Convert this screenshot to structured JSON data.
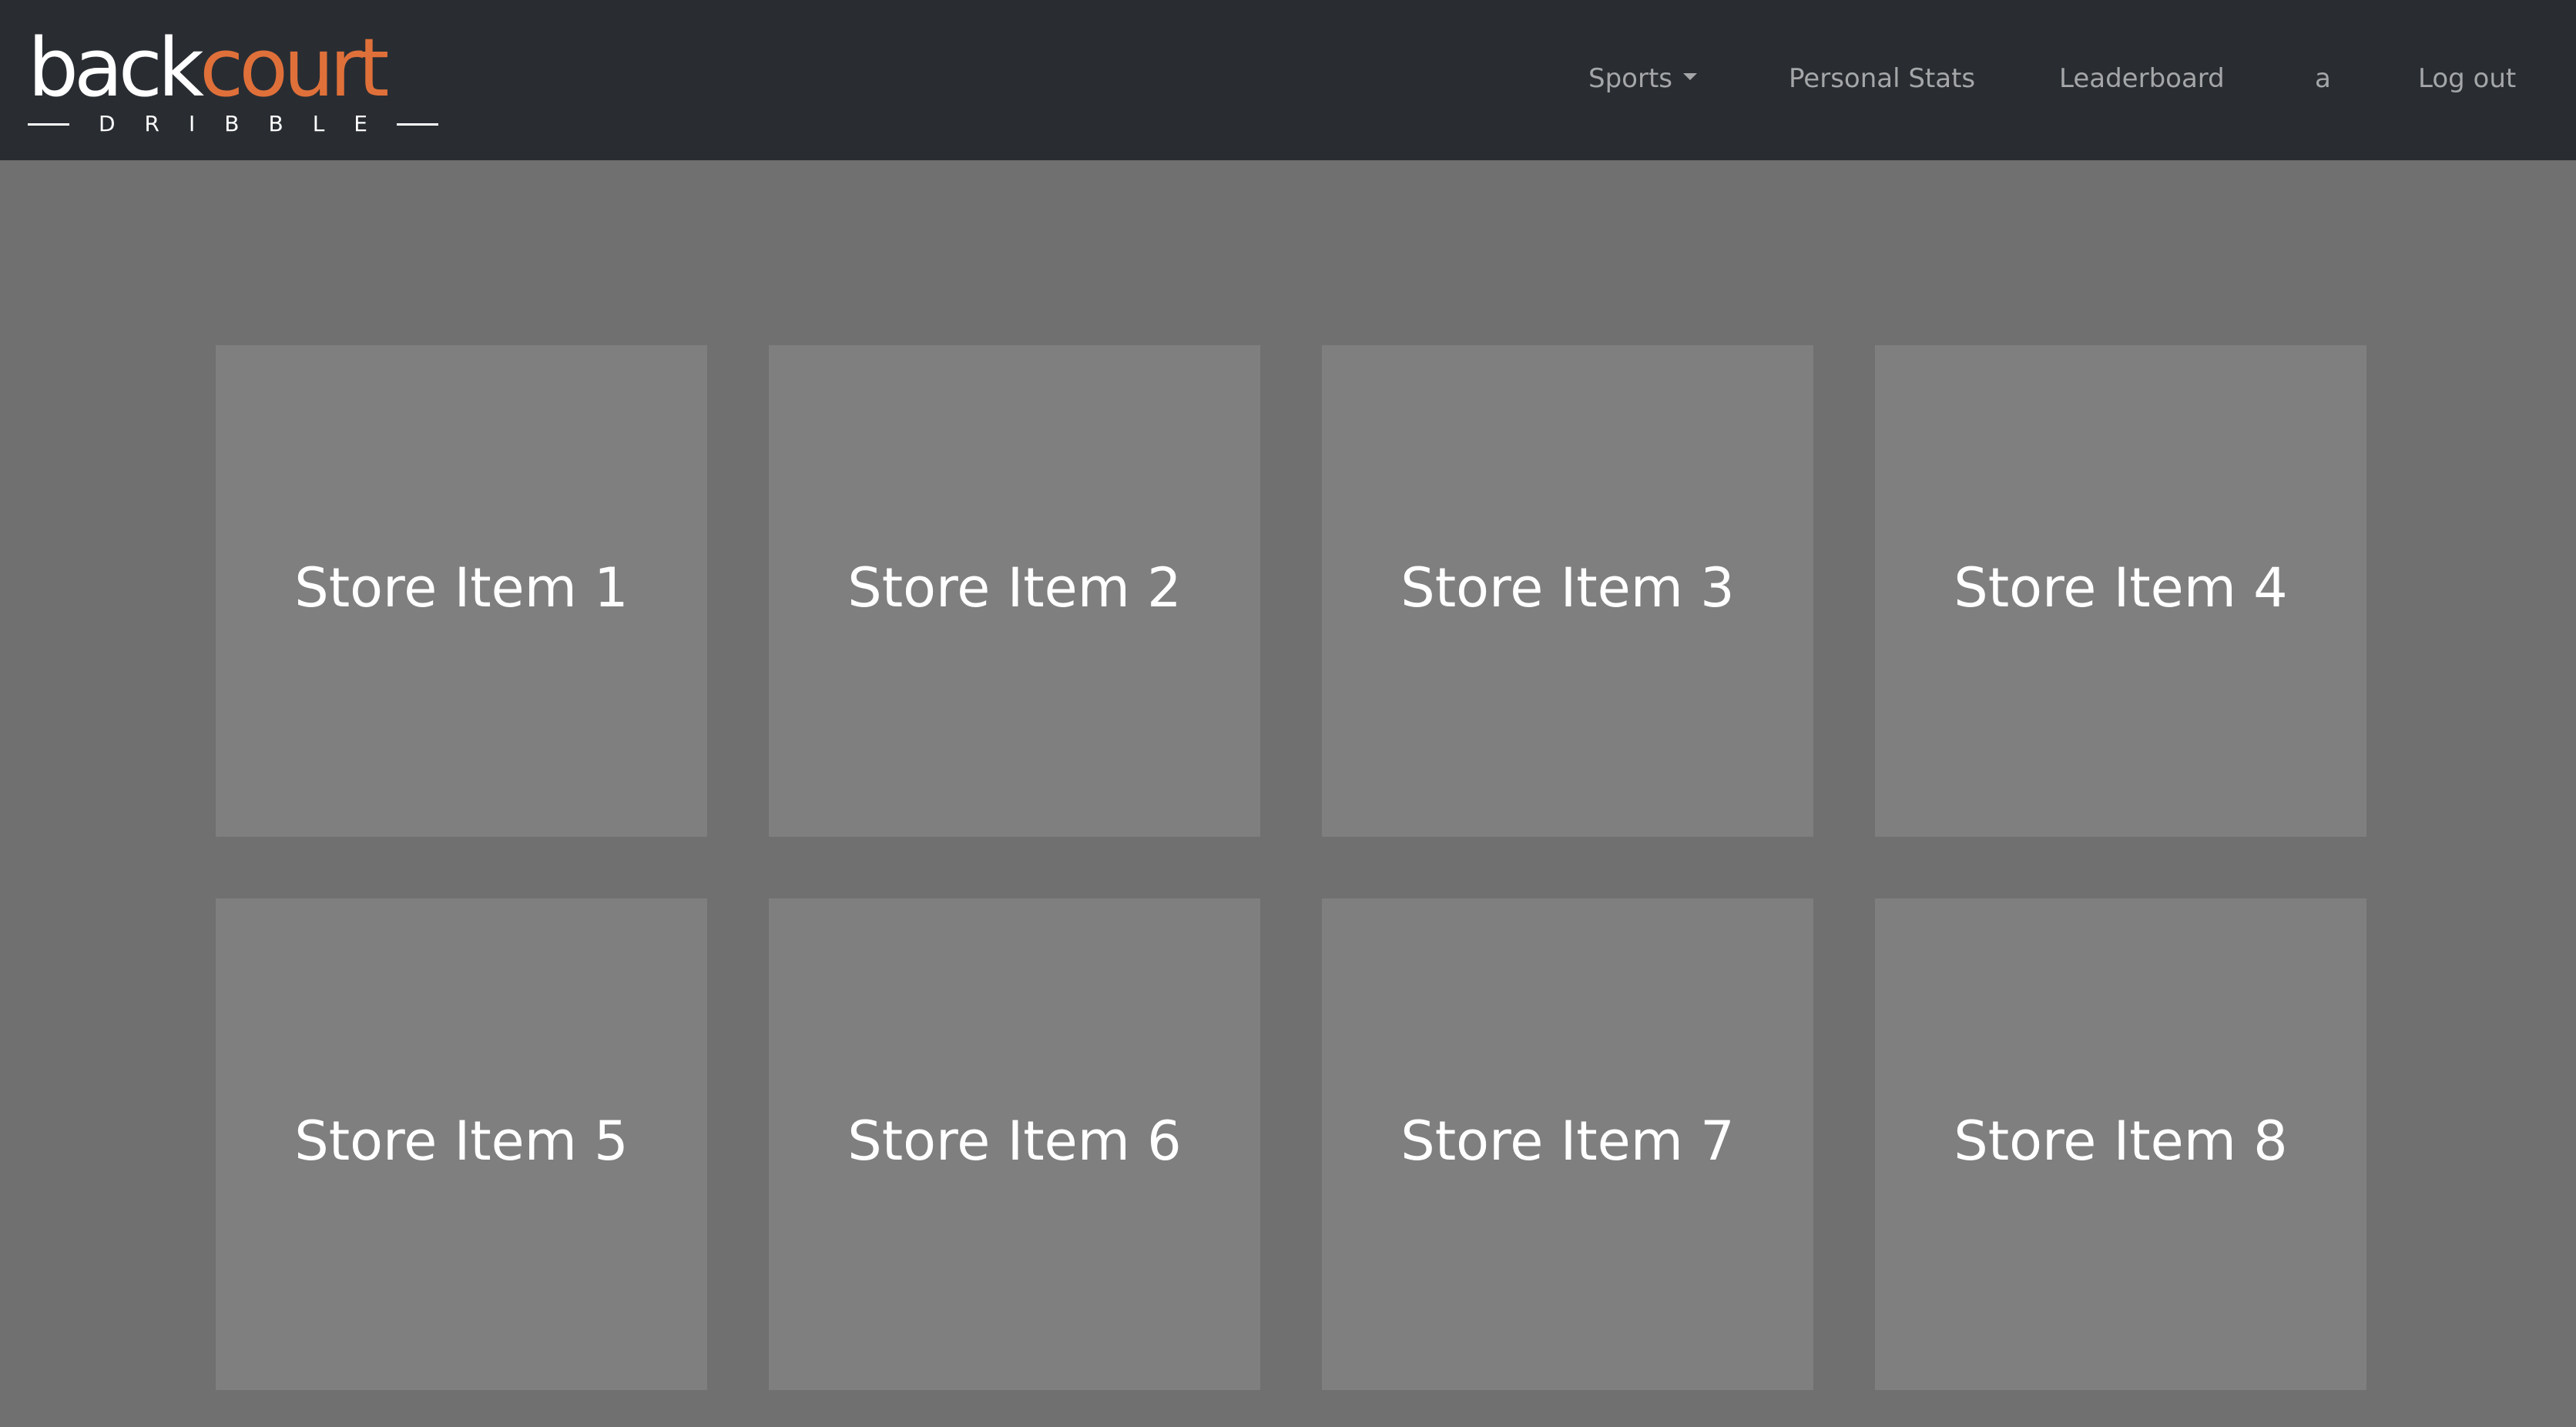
{
  "brand": {
    "word_part1": "back",
    "word_part2": "court",
    "tagline": "DRIBBLE",
    "accent_color": "#e0703a"
  },
  "nav": {
    "sports_label": "Sports",
    "personal_stats_label": "Personal Stats",
    "leaderboard_label": "Leaderboard",
    "user_label": "a",
    "logout_label": "Log out"
  },
  "store": {
    "items": [
      {
        "label": "Store Item 1"
      },
      {
        "label": "Store Item 2"
      },
      {
        "label": "Store Item 3"
      },
      {
        "label": "Store Item 4"
      },
      {
        "label": "Store Item 5"
      },
      {
        "label": "Store Item 6"
      },
      {
        "label": "Store Item 7"
      },
      {
        "label": "Store Item 8"
      }
    ]
  }
}
